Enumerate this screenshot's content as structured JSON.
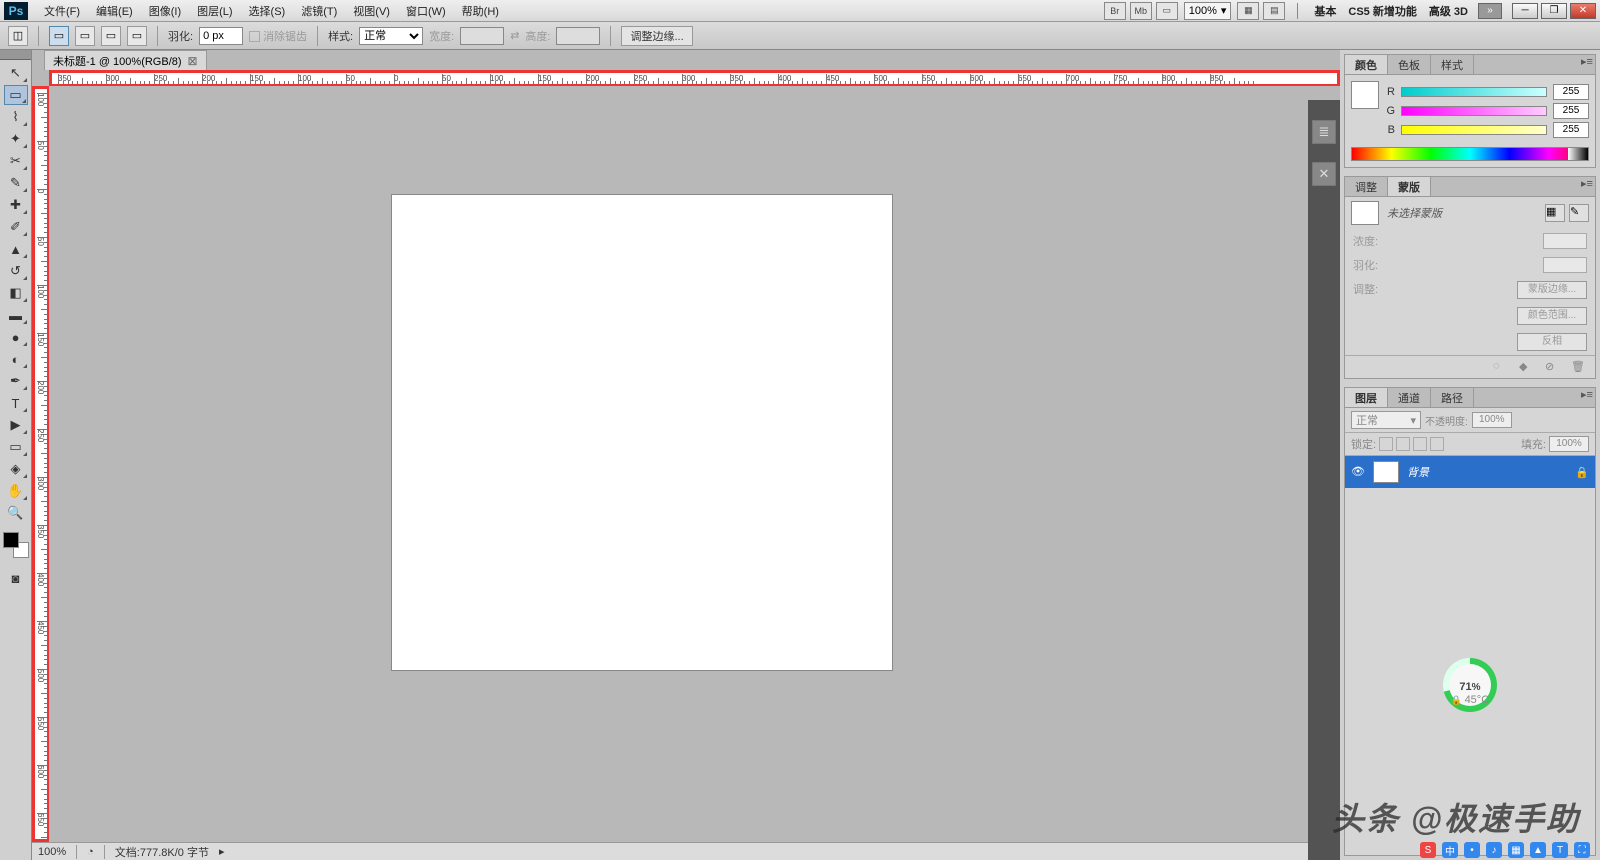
{
  "menubar": {
    "items": [
      "文件(F)",
      "编辑(E)",
      "图像(I)",
      "图层(L)",
      "选择(S)",
      "滤镜(T)",
      "视图(V)",
      "窗口(W)",
      "帮助(H)"
    ],
    "br": "Br",
    "mb": "Mb",
    "zoom": "100%",
    "workspace_basic": "基本",
    "workspace_cs5": "CS5 新增功能",
    "workspace_3d": "高级 3D"
  },
  "options": {
    "feather_lbl": "羽化:",
    "feather_val": "0 px",
    "antialias": "消除锯齿",
    "style_lbl": "样式:",
    "style_val": "正常",
    "width_lbl": "宽度:",
    "height_lbl": "高度:",
    "refine": "调整边缘..."
  },
  "doc_tab": "未标题-1 @ 100%(RGB/8)",
  "status": {
    "zoom": "100%",
    "doc": "文档:777.8K/0 字节"
  },
  "color_panel": {
    "tabs": [
      "颜色",
      "色板",
      "样式"
    ],
    "r": "R",
    "g": "G",
    "b": "B",
    "r_val": "255",
    "g_val": "255",
    "b_val": "255"
  },
  "mask_panel": {
    "tabs": [
      "调整",
      "蒙版"
    ],
    "no_sel": "未选择蒙版",
    "density": "浓度:",
    "feather": "羽化:",
    "adjust": "调整:",
    "btn_edge": "蒙版边缘...",
    "btn_range": "颜色范围...",
    "btn_invert": "反相"
  },
  "layer_panel": {
    "tabs": [
      "图层",
      "通道",
      "路径"
    ],
    "blend": "正常",
    "opacity_lbl": "不透明度:",
    "opacity": "100%",
    "lock_lbl": "锁定:",
    "fill_lbl": "填充:",
    "fill": "100%",
    "bg_layer": "背景"
  },
  "perf": {
    "pct": "71",
    "unit": "%",
    "temp": "45°C"
  },
  "watermark": "头条 @极速手助",
  "ruler_h": [
    -350,
    -300,
    -250,
    -200,
    -150,
    -100,
    -50,
    0,
    50,
    100,
    150,
    200,
    250,
    300,
    350,
    400,
    450,
    500,
    550,
    600,
    650,
    700,
    750,
    800,
    850
  ],
  "ruler_v": [
    -100,
    -50,
    0,
    50,
    100,
    150,
    200,
    250,
    300,
    350,
    400,
    450,
    500,
    550,
    600,
    650
  ]
}
